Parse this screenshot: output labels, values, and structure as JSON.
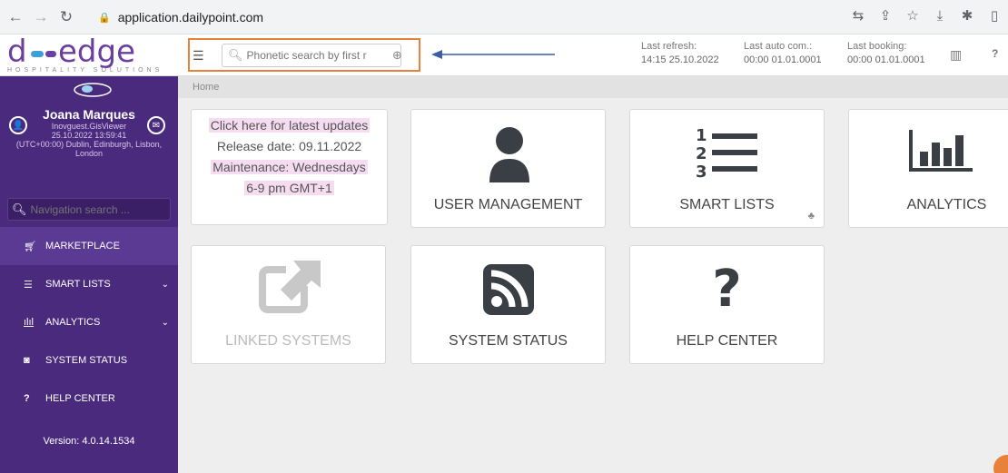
{
  "browser": {
    "url": "application.dailypoint.com",
    "icons": [
      "translate-icon",
      "share-icon",
      "star-icon",
      "download-icon",
      "extensions-icon",
      "sidepanel-icon"
    ]
  },
  "header": {
    "logo_text": "dedge",
    "logo_sub": "HOSPITALITY SOLUTIONS",
    "search_placeholder": "Phonetic search by first r",
    "last_refresh_label": "Last refresh:",
    "last_refresh_value": "14:15 25.10.2022",
    "last_auto_com_label": "Last auto com.:",
    "last_auto_com_value": "00:00 01.01.0001",
    "last_booking_label": "Last booking:",
    "last_booking_value": "00:00 01.01.0001",
    "help_label": "?"
  },
  "sidebar": {
    "user_name": "Joana Marques",
    "user_account": "Inovguest.GisViewer",
    "user_datetime": "25.10.2022 13:59:41",
    "user_tz_line1": "(UTC+00:00) Dublin, Edinburgh, Lisbon,",
    "user_tz_line2": "London",
    "nav_search_placeholder": "Navigation search ...",
    "items": [
      {
        "label": "MARKETPLACE",
        "icon": "cart-icon",
        "glyph": "🛒",
        "active": true
      },
      {
        "label": "SMART LISTS",
        "icon": "list-icon",
        "glyph": "☰",
        "chevron": "⌄"
      },
      {
        "label": "ANALYTICS",
        "icon": "bar-chart-icon",
        "glyph": "📊",
        "chevron": "⌄"
      },
      {
        "label": "SYSTEM STATUS",
        "icon": "rss-icon",
        "glyph": "◙"
      },
      {
        "label": "HELP CENTER",
        "icon": "question-icon",
        "glyph": "?"
      }
    ],
    "version": "Version: 4.0.14.1534"
  },
  "main": {
    "breadcrumb": "Home",
    "updates": {
      "line1": "Click here for latest updates",
      "line2": "Release date: 09.11.2022",
      "line3": "Maintenance: Wednesdays",
      "line4": "6-9 pm GMT+1"
    },
    "tiles": {
      "user_management": "USER MANAGEMENT",
      "smart_lists": "SMART LISTS",
      "analytics": "ANALYTICS",
      "linked_systems": "LINKED SYSTEMS",
      "system_status": "SYSTEM STATUS",
      "help_center": "HELP CENTER",
      "help_glyph": "?",
      "smart_numbers": [
        "1",
        "2",
        "3"
      ]
    }
  },
  "colors": {
    "sidebar": "#4a2a7d",
    "highlight": "#e8813a",
    "arrow": "#3a5ea8"
  }
}
